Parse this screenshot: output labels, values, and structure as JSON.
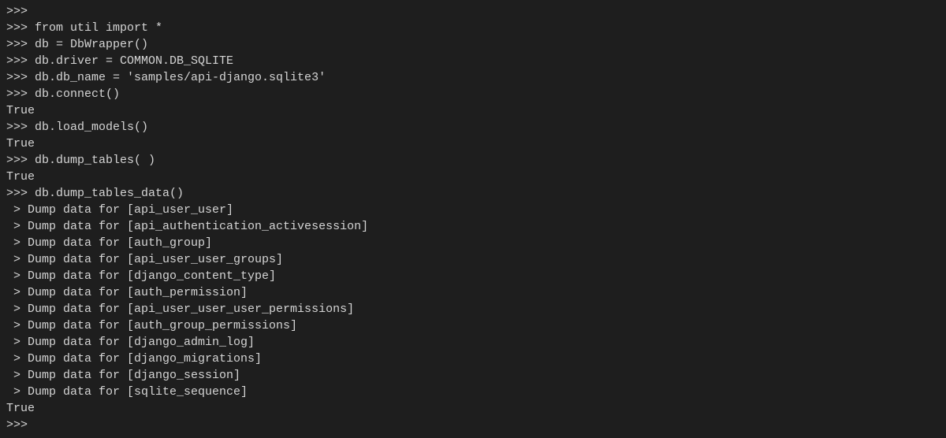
{
  "lines": [
    ">>>",
    ">>> from util import *",
    ">>> db = DbWrapper()",
    ">>> db.driver = COMMON.DB_SQLITE",
    ">>> db.db_name = 'samples/api-django.sqlite3'",
    ">>> db.connect()",
    "True",
    ">>> db.load_models()",
    "True",
    ">>> db.dump_tables( )",
    "True",
    ">>> db.dump_tables_data()",
    " > Dump data for [api_user_user]",
    " > Dump data for [api_authentication_activesession]",
    " > Dump data for [auth_group]",
    " > Dump data for [api_user_user_groups]",
    " > Dump data for [django_content_type]",
    " > Dump data for [auth_permission]",
    " > Dump data for [api_user_user_user_permissions]",
    " > Dump data for [auth_group_permissions]",
    " > Dump data for [django_admin_log]",
    " > Dump data for [django_migrations]",
    " > Dump data for [django_session]",
    " > Dump data for [sqlite_sequence]",
    "True",
    ">>>"
  ]
}
